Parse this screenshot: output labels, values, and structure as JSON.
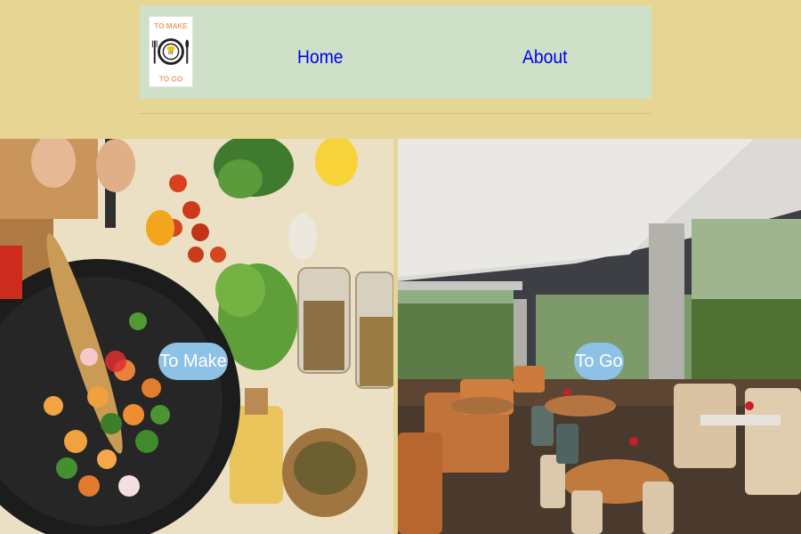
{
  "header": {
    "logo": {
      "text_top": "TO MAKE",
      "text_mid": "or",
      "text_bottom": "TO GO"
    },
    "nav": {
      "home_label": "Home",
      "about_label": "About"
    }
  },
  "tiles": {
    "make": {
      "button_label": "To Make"
    },
    "go": {
      "button_label": "To Go"
    }
  },
  "colors": {
    "page_background": "#e6d593",
    "header_background": "#cfe0c9",
    "link": "#0000ee",
    "pill": "#8dc1e6"
  }
}
